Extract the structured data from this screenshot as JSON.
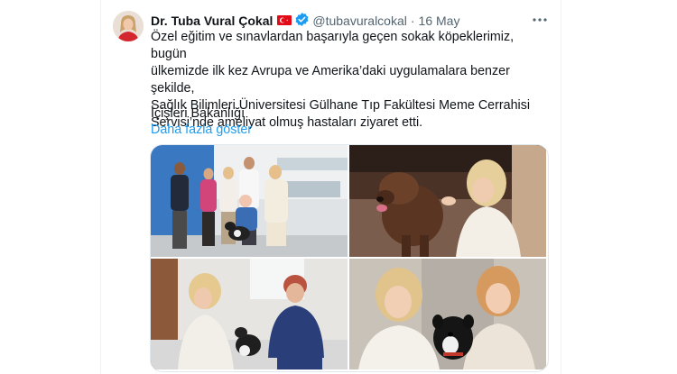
{
  "tweet": {
    "author_name": "Dr. Tuba Vural Çokal",
    "flag": "🇹🇷",
    "handle": "@tubavuralcokal",
    "separator": "·",
    "date": "16 May",
    "text_lines": [
      "Özel eğitim ve sınavlardan başarıyla geçen sokak köpeklerimiz, bugün",
      "ülkemizde ilk kez Avrupa ve Amerika’daki uygulamalara benzer şekilde,",
      "Sağlık Bilimleri Üniversitesi Gülhane Tıp Fakültesi Meme Cerrahisi",
      "Servisi’nde ameliyat olmuş hastaları ziyaret etti."
    ],
    "signature": "İçişleri Bakanlığı",
    "show_more": "Daha fazla göster",
    "more_icon": "more-horizontal-icon",
    "verified_icon": "verified-badge-icon",
    "accent_color": "#1d9bf0"
  },
  "media": {
    "photos": [
      {
        "name": "photo-group-hospital-room"
      },
      {
        "name": "photo-woman-petting-dog"
      },
      {
        "name": "photo-patient-with-dog"
      },
      {
        "name": "photo-women-with-dog-closeup"
      }
    ]
  }
}
